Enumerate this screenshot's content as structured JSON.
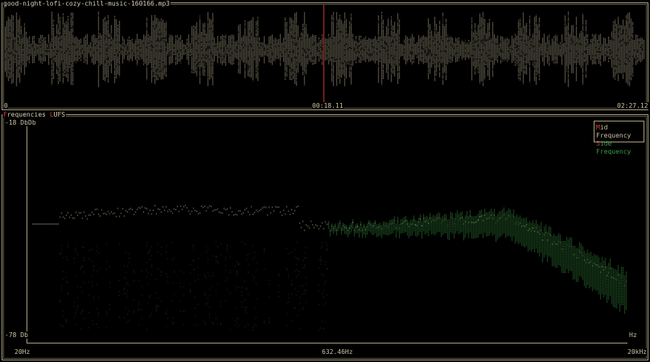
{
  "waveform": {
    "file_name": "good-night-lofi-cozy-chill-music-160166.mp3",
    "start_time": "0",
    "current_time": "00:18.11",
    "end_time": "02:27.12",
    "playhead_fraction": 0.123
  },
  "spectrum": {
    "title_first": "F",
    "title_rest": "requencies",
    "mode_first": "L",
    "mode_rest": "UFS",
    "db_top": "-18 Db",
    "db_unit": "Db",
    "db_bottom": "-78 Db",
    "hz_unit": "Hz",
    "freq_min": "20Hz",
    "freq_mid": "632.46Hz",
    "freq_max": "20kHz",
    "legend": {
      "mid_first": "M",
      "mid_rest": "id Frequency",
      "side_first": "S",
      "side_rest": "ide Frequency"
    }
  },
  "colors": {
    "border": "#a89f80",
    "mid": "#c8c0a0",
    "side": "#3c9a44",
    "accent": "#d04030"
  }
}
